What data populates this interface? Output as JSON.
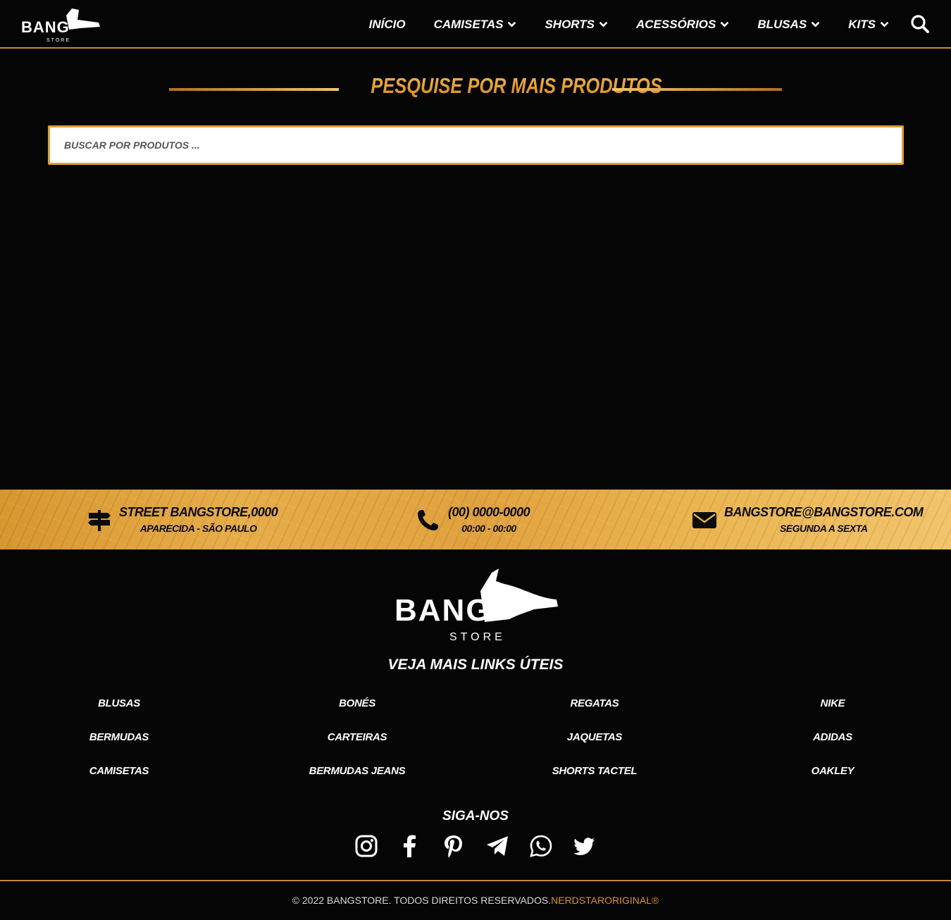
{
  "colors": {
    "accent": "#e09a33",
    "background": "#050505",
    "band": "#e6ad4a"
  },
  "header": {
    "logo": {
      "text": "BANG",
      "subtext": "STORE"
    },
    "nav": [
      {
        "label": "INÍCIO",
        "has_dropdown": false
      },
      {
        "label": "CAMISETAS",
        "has_dropdown": true
      },
      {
        "label": "SHORTS",
        "has_dropdown": true
      },
      {
        "label": "ACESSÓRIOS",
        "has_dropdown": true
      },
      {
        "label": "BLUSAS",
        "has_dropdown": true
      },
      {
        "label": "KITS",
        "has_dropdown": true
      }
    ],
    "search_icon": "search-icon"
  },
  "search": {
    "title": "PESQUISE POR MAIS PRODUTOS",
    "placeholder": "BUSCAR POR PRODUTOS ..."
  },
  "contact": {
    "address": {
      "icon": "signpost-icon",
      "main": "STREET BANGSTORE,0000",
      "sub": "APARECIDA - SÃO PAULO"
    },
    "phone": {
      "icon": "phone-icon",
      "main": "(00) 0000-0000",
      "sub": "00:00 - 00:00"
    },
    "email": {
      "icon": "envelope-icon",
      "main": "BANGSTORE@BANGSTORE.COM",
      "sub": "SEGUNDA A SEXTA"
    }
  },
  "footer": {
    "logo": {
      "text": "BANG",
      "subtext": "STORE"
    },
    "links_title": "VEJA MAIS LINKS ÚTEIS",
    "link_columns": [
      [
        "BLUSAS",
        "BERMUDAS",
        "CAMISETAS"
      ],
      [
        "BONÉS",
        "CARTEIRAS",
        "BERMUDAS JEANS"
      ],
      [
        "REGATAS",
        "JAQUETAS",
        "SHORTS TACTEL"
      ],
      [
        "NIKE",
        "ADIDAS",
        "OAKLEY"
      ]
    ],
    "follow_title": "SIGA-NOS",
    "socials": [
      "instagram-icon",
      "facebook-icon",
      "pinterest-icon",
      "telegram-icon",
      "whatsapp-icon",
      "twitter-icon"
    ],
    "copyright": "© 2022 BANGSTORE. TODOS DIREITOS RESERVADOS.",
    "copyright_brand": "NERDSTARORIGINAL®"
  }
}
